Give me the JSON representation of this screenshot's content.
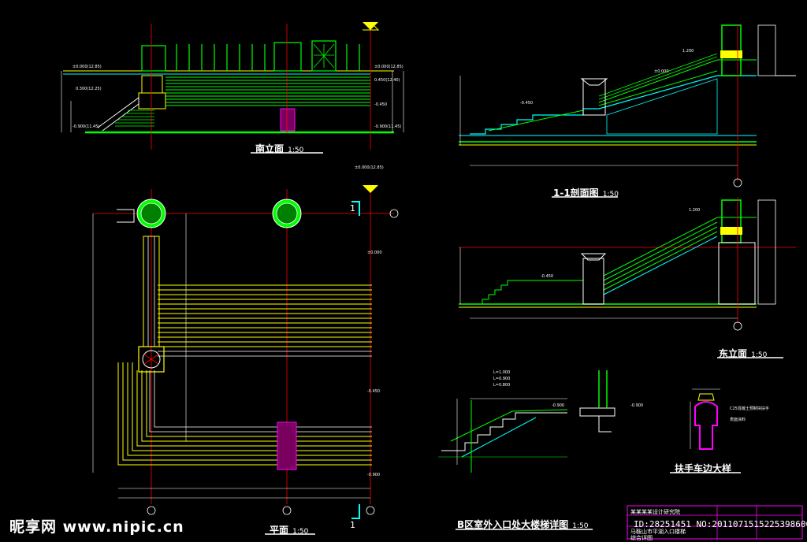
{
  "drawings": {
    "south_elevation": {
      "title": "南立面",
      "scale": "1:50"
    },
    "section_1_1": {
      "title": "1-1剖面图",
      "scale": "1:50"
    },
    "east_elevation": {
      "title": "东立面",
      "scale": "1:50"
    },
    "plan": {
      "title": "平面",
      "scale": "1:50"
    },
    "stair_detail": {
      "title": "B区室外入口处大楼梯详图",
      "scale": "1:50"
    },
    "handrail_detail": {
      "title": "扶手车边大样"
    }
  },
  "section_marks": {
    "top": "1",
    "bottom": "1"
  },
  "title_block": {
    "row1": "某某某某设计研究院",
    "row2": "马鞍山市平湖入口楼梯",
    "row3": "综合详图"
  },
  "watermark": {
    "logo": "昵享网 www.nipic.cn",
    "id": "ID:28251451 NO:20110715152253986000"
  },
  "colors": {
    "background": "#000000",
    "green": "#00ff00",
    "yellow": "#ffff00",
    "cyan": "#00ffff",
    "magenta": "#ff00ff",
    "red": "#ff0000",
    "white": "#ffffff"
  }
}
